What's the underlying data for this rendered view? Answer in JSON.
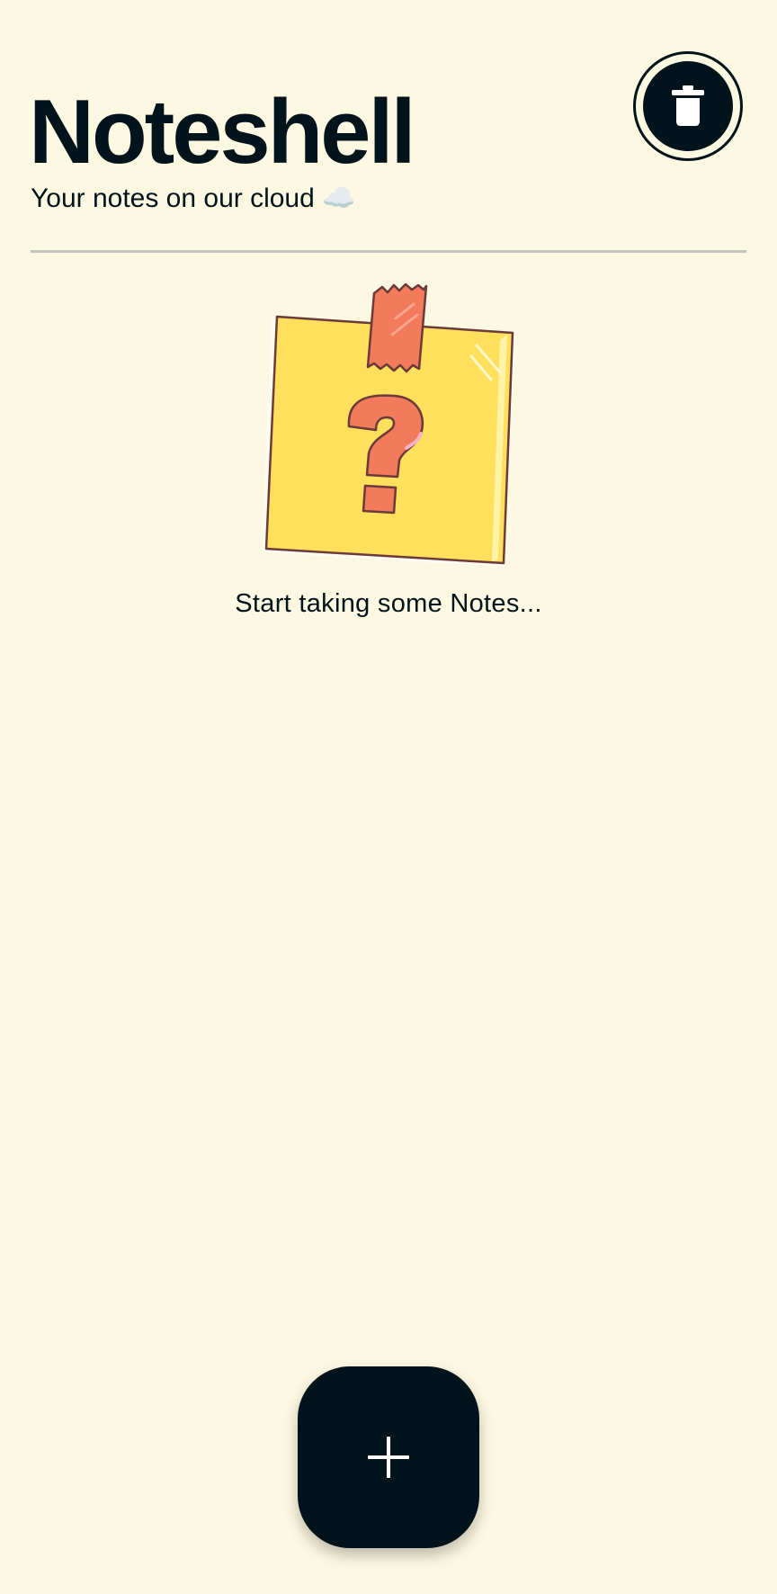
{
  "colors": {
    "background": "#FDF8E1",
    "primary": "#02141B",
    "on_primary": "#FFFFFF",
    "divider": "#C2C6BC",
    "note_yellow": "#FFDF5B",
    "note_accent": "#F27B5C",
    "note_outline": "#6B3B3B"
  },
  "header": {
    "title": "Noteshell",
    "subtitle": "Your notes on our cloud ☁️"
  },
  "toolbar": {
    "trash_icon": "trash-icon"
  },
  "empty_state": {
    "illustration": "sticky-note-question-mark",
    "message": "Start taking some Notes..."
  },
  "fab": {
    "icon": "plus-icon"
  }
}
